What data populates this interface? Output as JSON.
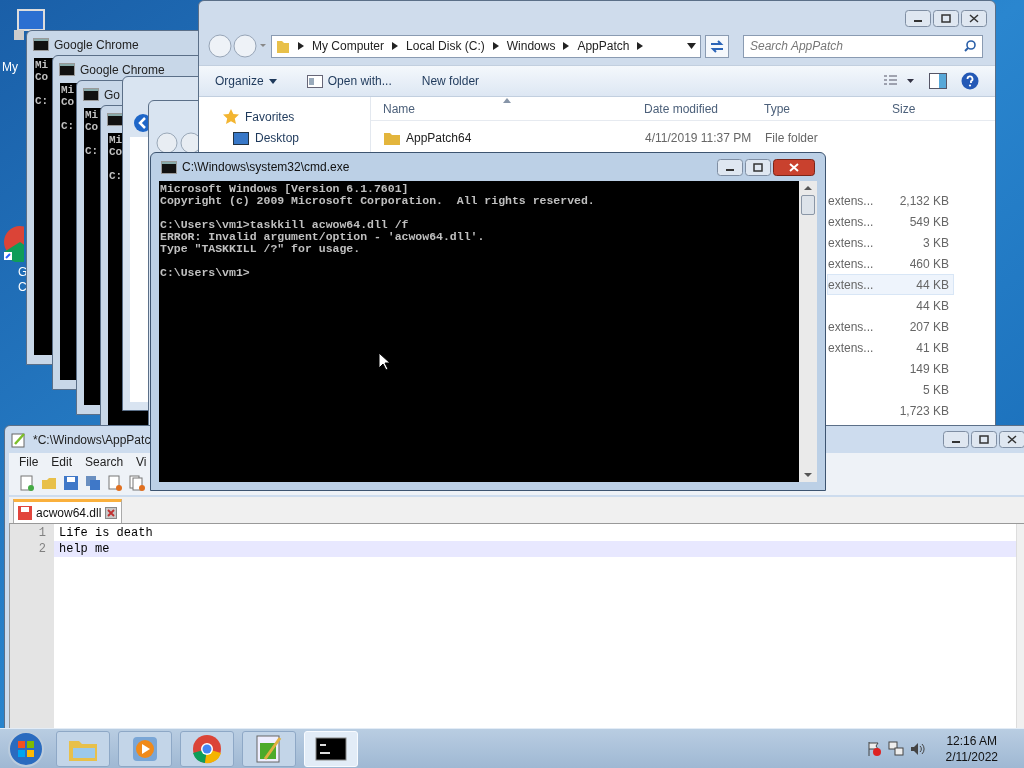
{
  "desktop_icons": [
    {
      "label": "My"
    },
    {
      "label": "G\nC"
    }
  ],
  "background_windows": [
    {
      "kind": "console",
      "title": "Google Chrome",
      "lines": [
        "Mi",
        "Co",
        "C:"
      ]
    },
    {
      "kind": "console",
      "title": "Google Chrome",
      "lines": [
        "Mi",
        "Co",
        "C:"
      ]
    },
    {
      "kind": "console",
      "title": "Go",
      "lines": [
        "Mi",
        "Co",
        "C:"
      ]
    },
    {
      "kind": "console",
      "lines": [
        "Mi",
        "Co",
        "C:"
      ]
    },
    {
      "kind": "explorer",
      "back_enabled": true
    },
    {
      "kind": "explorer",
      "back_enabled": false
    }
  ],
  "explorer": {
    "breadcrumbs": [
      "My Computer",
      "Local Disk (C:)",
      "Windows",
      "AppPatch"
    ],
    "search": {
      "placeholder": "Search AppPatch"
    },
    "toolbar": [
      "Organize",
      "Open with...",
      "New folder"
    ],
    "favorites": {
      "label": "Favorites",
      "items": [
        "Desktop"
      ]
    },
    "columns": [
      "Name",
      "Date modified",
      "Type",
      "Size"
    ],
    "rows": [
      {
        "name": "AppPatch64",
        "date": "4/11/2019 11:37 PM",
        "type": "File folder",
        "selected": false
      },
      {
        "type": "extens...",
        "size": "2,132 KB",
        "selected": false
      },
      {
        "type": "extens...",
        "size": "549 KB",
        "selected": false
      },
      {
        "type": "extens...",
        "size": "3 KB",
        "selected": false
      },
      {
        "type": "extens...",
        "size": "460 KB",
        "selected": false
      },
      {
        "type": "extens...",
        "size": "44 KB",
        "selected": true
      },
      {
        "size": "44 KB",
        "selected": false
      },
      {
        "type": "extens...",
        "size": "207 KB",
        "selected": false
      },
      {
        "type": "extens...",
        "size": "41 KB",
        "selected": false
      },
      {
        "size": "149 KB",
        "selected": false
      },
      {
        "size": "5 KB",
        "selected": false
      },
      {
        "size": "1,723 KB",
        "selected": false
      }
    ]
  },
  "cmd": {
    "title": "C:\\Windows\\system32\\cmd.exe",
    "blocks": [
      [
        "Microsoft Windows [Version 6.1.7601]",
        "Copyright (c) 2009 Microsoft Corporation.  All rights reserved."
      ],
      [
        "C:\\Users\\vm1>taskkill acwow64.dll /f",
        "ERROR: Invalid argument/option - 'acwow64.dll'.",
        "Type \"TASKKILL /?\" for usage."
      ],
      [
        "C:\\Users\\vm1>"
      ]
    ]
  },
  "notepad": {
    "title": "*C:\\Windows\\AppPatc",
    "menu": [
      "File",
      "Edit",
      "Search",
      "Vi"
    ],
    "tab": "acwow64.dll",
    "lines": [
      {
        "number": "1",
        "text": "Life is death",
        "selected": false
      },
      {
        "number": "2",
        "text": "help me",
        "selected": true
      }
    ]
  },
  "taskbar": {
    "buttons": [
      {
        "kind": "folder",
        "selected": false
      },
      {
        "kind": "media",
        "selected": false
      },
      {
        "kind": "chrome",
        "selected": false
      },
      {
        "kind": "notepad",
        "selected": false
      },
      {
        "kind": "console",
        "selected": true
      }
    ],
    "time": "12:16 AM",
    "date": "2/11/2022"
  }
}
